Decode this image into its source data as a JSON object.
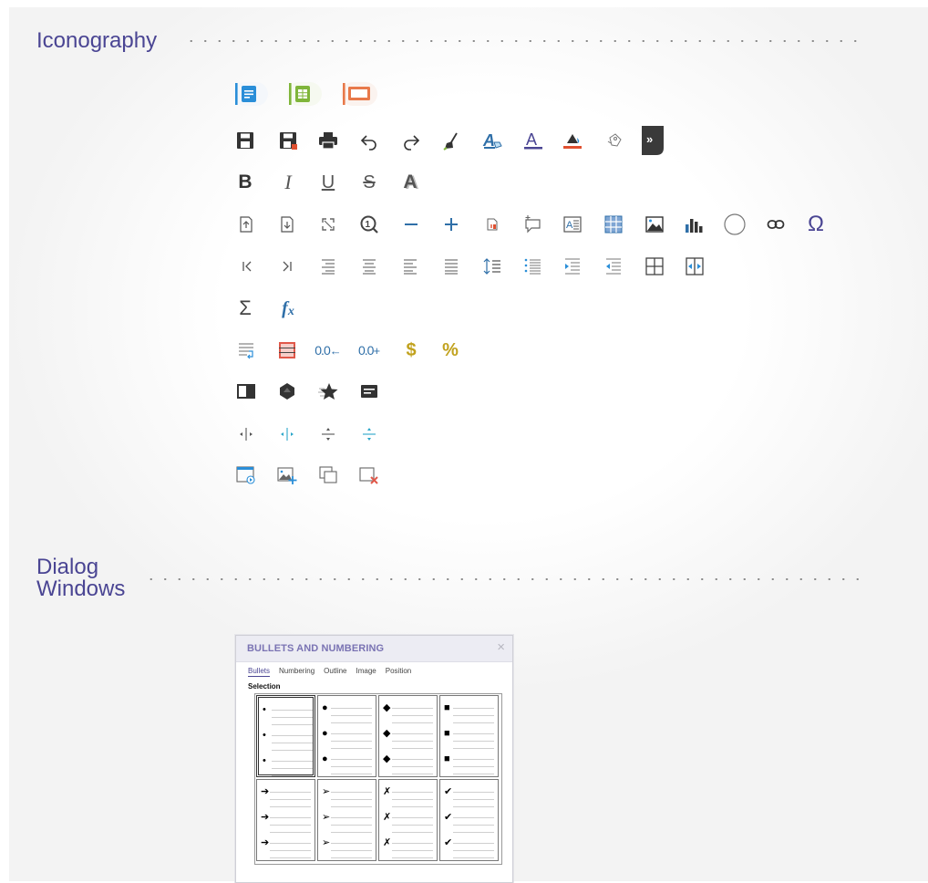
{
  "sections": {
    "iconography_title": "Iconography",
    "dialog_title_line1": "Dialog",
    "dialog_title_line2": "Windows"
  },
  "text_icons": {
    "bold": "B",
    "italic": "I",
    "underline": "U",
    "strikethrough": "S",
    "shadow": "A",
    "sum": "Σ",
    "function": "f",
    "function_sub": "x",
    "dec_dec": "0.0",
    "inc_dec": "0.0",
    "currency": "$",
    "percent": "%",
    "omega": "Ω",
    "first": "K",
    "last": "›|"
  },
  "dialog": {
    "title": "BULLETS AND NUMBERING",
    "close": "×",
    "tabs": [
      "Bullets",
      "Numbering",
      "Outline",
      "Image",
      "Position"
    ],
    "selection_label": "Selection",
    "bullet_marks": [
      "•",
      "●",
      "◆",
      "■",
      "➔",
      "➢",
      "✗",
      "✔"
    ]
  },
  "colors": {
    "accent": "#4a4593",
    "blue": "#2a8ed8",
    "green": "#7fb53a",
    "orange": "#e8794a",
    "dark": "#333333",
    "grey": "#666666",
    "teal": "#2aa6c9",
    "gold": "#c1a21e",
    "red": "#e0584a"
  }
}
